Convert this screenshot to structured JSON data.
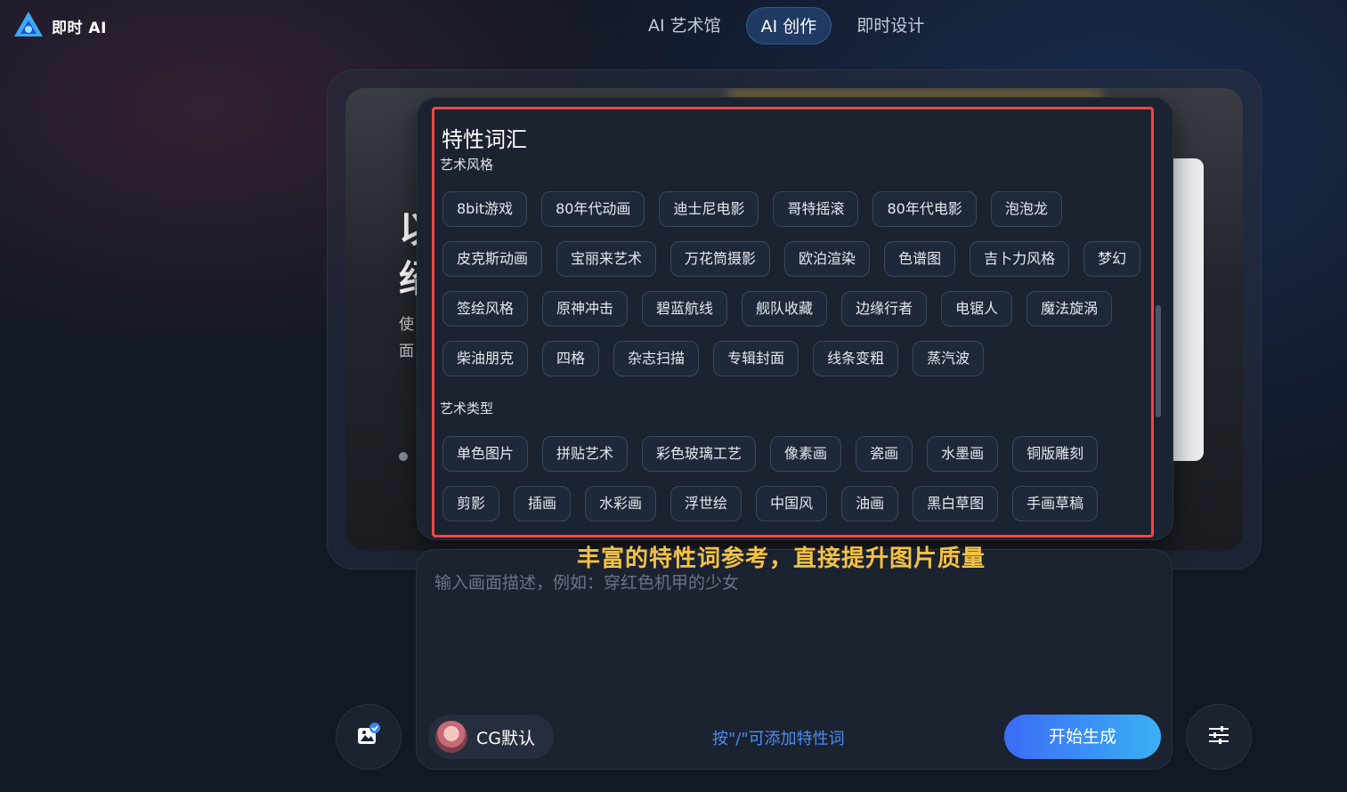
{
  "app": {
    "logo_text": "即时 AI"
  },
  "nav": {
    "tabs": [
      {
        "label": "AI 艺术馆"
      },
      {
        "label": "AI 创作"
      },
      {
        "label": "即时设计"
      }
    ],
    "active_index": 1
  },
  "background": {
    "line1": "以",
    "line2": "绍",
    "text1": "使",
    "text2": "面"
  },
  "popup": {
    "title": "特性词汇",
    "sections": [
      {
        "label": "艺术风格",
        "rows": [
          [
            "8bit游戏",
            "80年代动画",
            "迪士尼电影",
            "哥特摇滚",
            "80年代电影",
            "泡泡龙"
          ],
          [
            "皮克斯动画",
            "宝丽来艺术",
            "万花筒摄影",
            "欧泊渲染",
            "色谱图",
            "吉卜力风格",
            "梦幻"
          ],
          [
            "签绘风格",
            "原神冲击",
            "碧蓝航线",
            "舰队收藏",
            "边缘行者",
            "电锯人",
            "魔法旋涡"
          ],
          [
            "柴油朋克",
            "四格",
            "杂志扫描",
            "专辑封面",
            "线条变粗",
            "蒸汽波"
          ]
        ]
      },
      {
        "label": "艺术类型",
        "rows": [
          [
            "单色图片",
            "拼贴艺术",
            "彩色玻璃工艺",
            "像素画",
            "瓷画",
            "水墨画",
            "铜版雕刻"
          ],
          [
            "剪影",
            "插画",
            "水彩画",
            "浮世绘",
            "中国风",
            "油画",
            "黑白草图",
            "手画草稿"
          ]
        ]
      }
    ]
  },
  "annotation": "丰富的特性词参考，直接提升图片质量",
  "prompt": {
    "placeholder": "输入画面描述，例如：穿红色机甲的少女",
    "value": ""
  },
  "model": {
    "label": "CG默认"
  },
  "hint": "按\"/\"可添加特性词",
  "generate_label": "开始生成",
  "colors": {
    "accent": "#3b6cf5",
    "highlight": "#e84a4a",
    "annotation": "#f5c242"
  }
}
